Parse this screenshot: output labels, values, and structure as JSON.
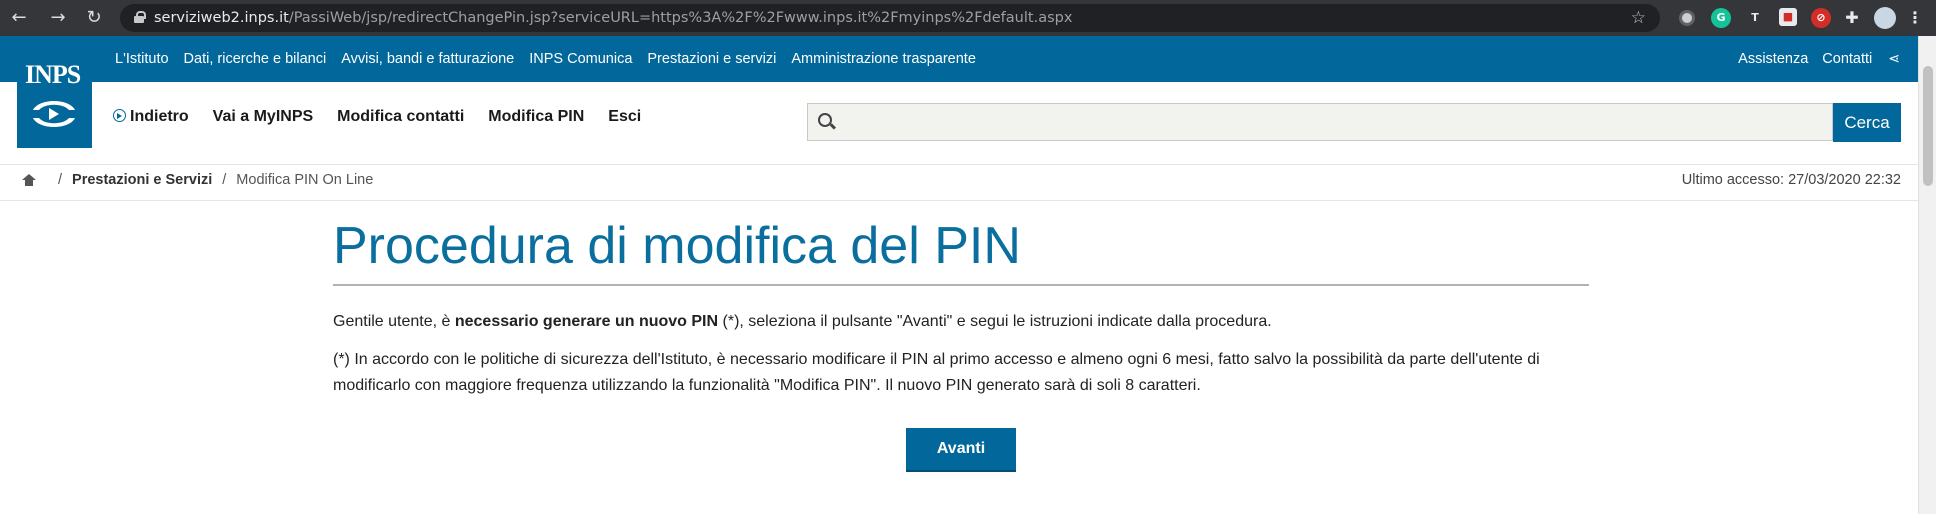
{
  "browser": {
    "url_host": "serviziweb2.inps.it",
    "url_rest": "/PassiWeb/jsp/redirectChangePin.jsp?serviceURL=https%3A%2F%2Fwww.inps.it%2Fmyinps%2Fdefault.aspx",
    "icons": [
      "back-icon",
      "forward-icon",
      "reload-icon",
      "lock-icon",
      "star-icon",
      "extension-icon",
      "grammarly-icon",
      "translate-icon",
      "lastpass-icon",
      "puzzle-icon",
      "profile-avatar",
      "menu-icon"
    ],
    "ext_translate_label": "T"
  },
  "header": {
    "logo_text": "INPS",
    "top_nav": [
      "L'Istituto",
      "Dati, ricerche e bilanci",
      "Avvisi, bandi e fatturazione",
      "INPS Comunica",
      "Prestazioni e servizi",
      "Amministrazione trasparente"
    ],
    "top_links": [
      "Assistenza",
      "Contatti"
    ],
    "sub_nav": {
      "back": "Indietro",
      "myinps": "Vai a MyINPS",
      "contacts": "Modifica contatti",
      "pin": "Modifica PIN",
      "exit": "Esci"
    },
    "search_placeholder": "",
    "search_button": "Cerca"
  },
  "breadcrumb": {
    "sep": "/",
    "items": [
      "Prestazioni e Servizi",
      "Modifica PIN On Line"
    ],
    "last_access": "Ultimo accesso: 27/03/2020 22:32"
  },
  "content": {
    "title": "Procedura di modifica del PIN",
    "p1_a": "Gentile utente, è ",
    "p1_bold": "necessario generare un nuovo PIN",
    "p1_b": " (*), seleziona il pulsante \"Avanti\" e segui le istruzioni indicate dalla procedura.",
    "p2": "(*) In accordo con le politiche di sicurezza dell'Istituto, è necessario modificare il PIN al primo accesso e almeno ogni 6 mesi, fatto salvo la possibilità da parte dell'utente di modificarlo con maggiore frequenza utilizzando la funzionalità \"Modifica PIN\". Il nuovo PIN generato sarà di soli 8 caratteri.",
    "button": "Avanti"
  }
}
